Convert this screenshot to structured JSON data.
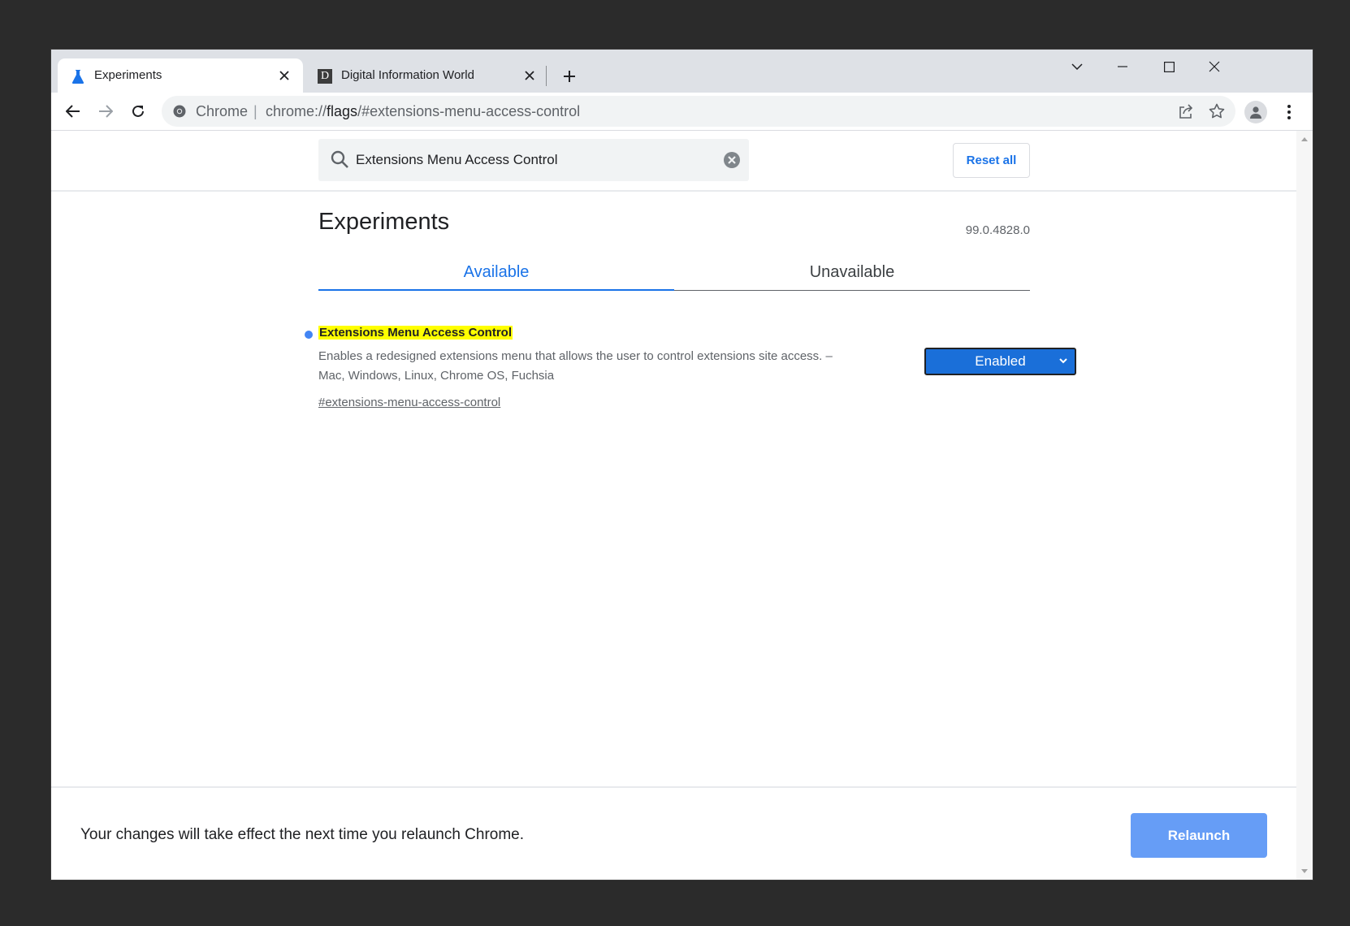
{
  "tabs": [
    {
      "title": "Experiments",
      "icon": "flask-icon",
      "active": true
    },
    {
      "title": "Digital Information World",
      "icon": "d-favicon-icon",
      "favicon_letter": "D",
      "active": false
    }
  ],
  "omnibox": {
    "site_name": "Chrome",
    "separator": "|",
    "url_prefix": "chrome://",
    "url_host": "flags",
    "url_path": "/#extensions-menu-access-control"
  },
  "search": {
    "value": "Extensions Menu Access Control",
    "placeholder": "Search flags"
  },
  "reset_label": "Reset all",
  "page_title": "Experiments",
  "version": "99.0.4828.0",
  "flag_tabs": {
    "available": "Available",
    "unavailable": "Unavailable"
  },
  "flag": {
    "name": "Extensions Menu Access Control",
    "description": "Enables a redesigned extensions menu that allows the user to control extensions site access. – Mac, Windows, Linux, Chrome OS, Fuchsia",
    "link": "#extensions-menu-access-control",
    "selected_option": "Enabled"
  },
  "footer": {
    "message": "Your changes will take effect the next time you relaunch Chrome.",
    "relaunch_label": "Relaunch"
  },
  "colors": {
    "accent": "#1a73e8",
    "highlight": "#ffff00",
    "relaunch": "#669df6",
    "select_bg": "#1a6fd9"
  }
}
